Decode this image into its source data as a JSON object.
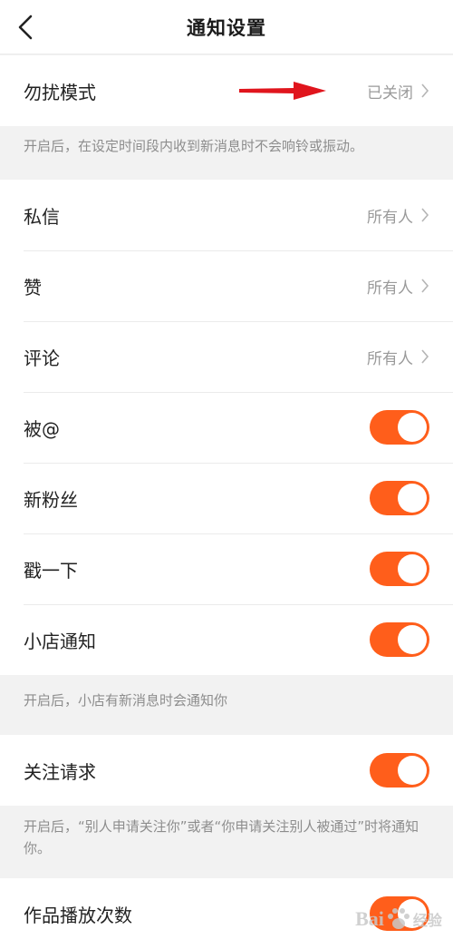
{
  "header": {
    "title": "通知设置",
    "back_icon": "chevron-left-icon"
  },
  "dnd": {
    "label": "勿扰模式",
    "value": "已关闭",
    "note": "开启后，在设定时间段内收到新消息时不会响铃或振动。"
  },
  "privacy_rows": [
    {
      "label": "私信",
      "value": "所有人"
    },
    {
      "label": "赞",
      "value": "所有人"
    },
    {
      "label": "评论",
      "value": "所有人"
    }
  ],
  "toggle_rows": [
    {
      "label": "被@",
      "on": true
    },
    {
      "label": "新粉丝",
      "on": true
    },
    {
      "label": "戳一下",
      "on": true
    },
    {
      "label": "小店通知",
      "on": true
    }
  ],
  "shop_note": "开启后，小店有新消息时会通知你",
  "follow": {
    "label": "关注请求",
    "on": true,
    "note": "开启后，“别人申请关注你”或者“你申请关注别人被通过”时将通知你。"
  },
  "plays": {
    "label": "作品播放次数",
    "on": true
  },
  "colors": {
    "toggle_on": "#ff5e1b",
    "annotation_arrow": "#e0151d"
  },
  "watermark": {
    "text_left": "Bai",
    "text_right": "经验"
  }
}
